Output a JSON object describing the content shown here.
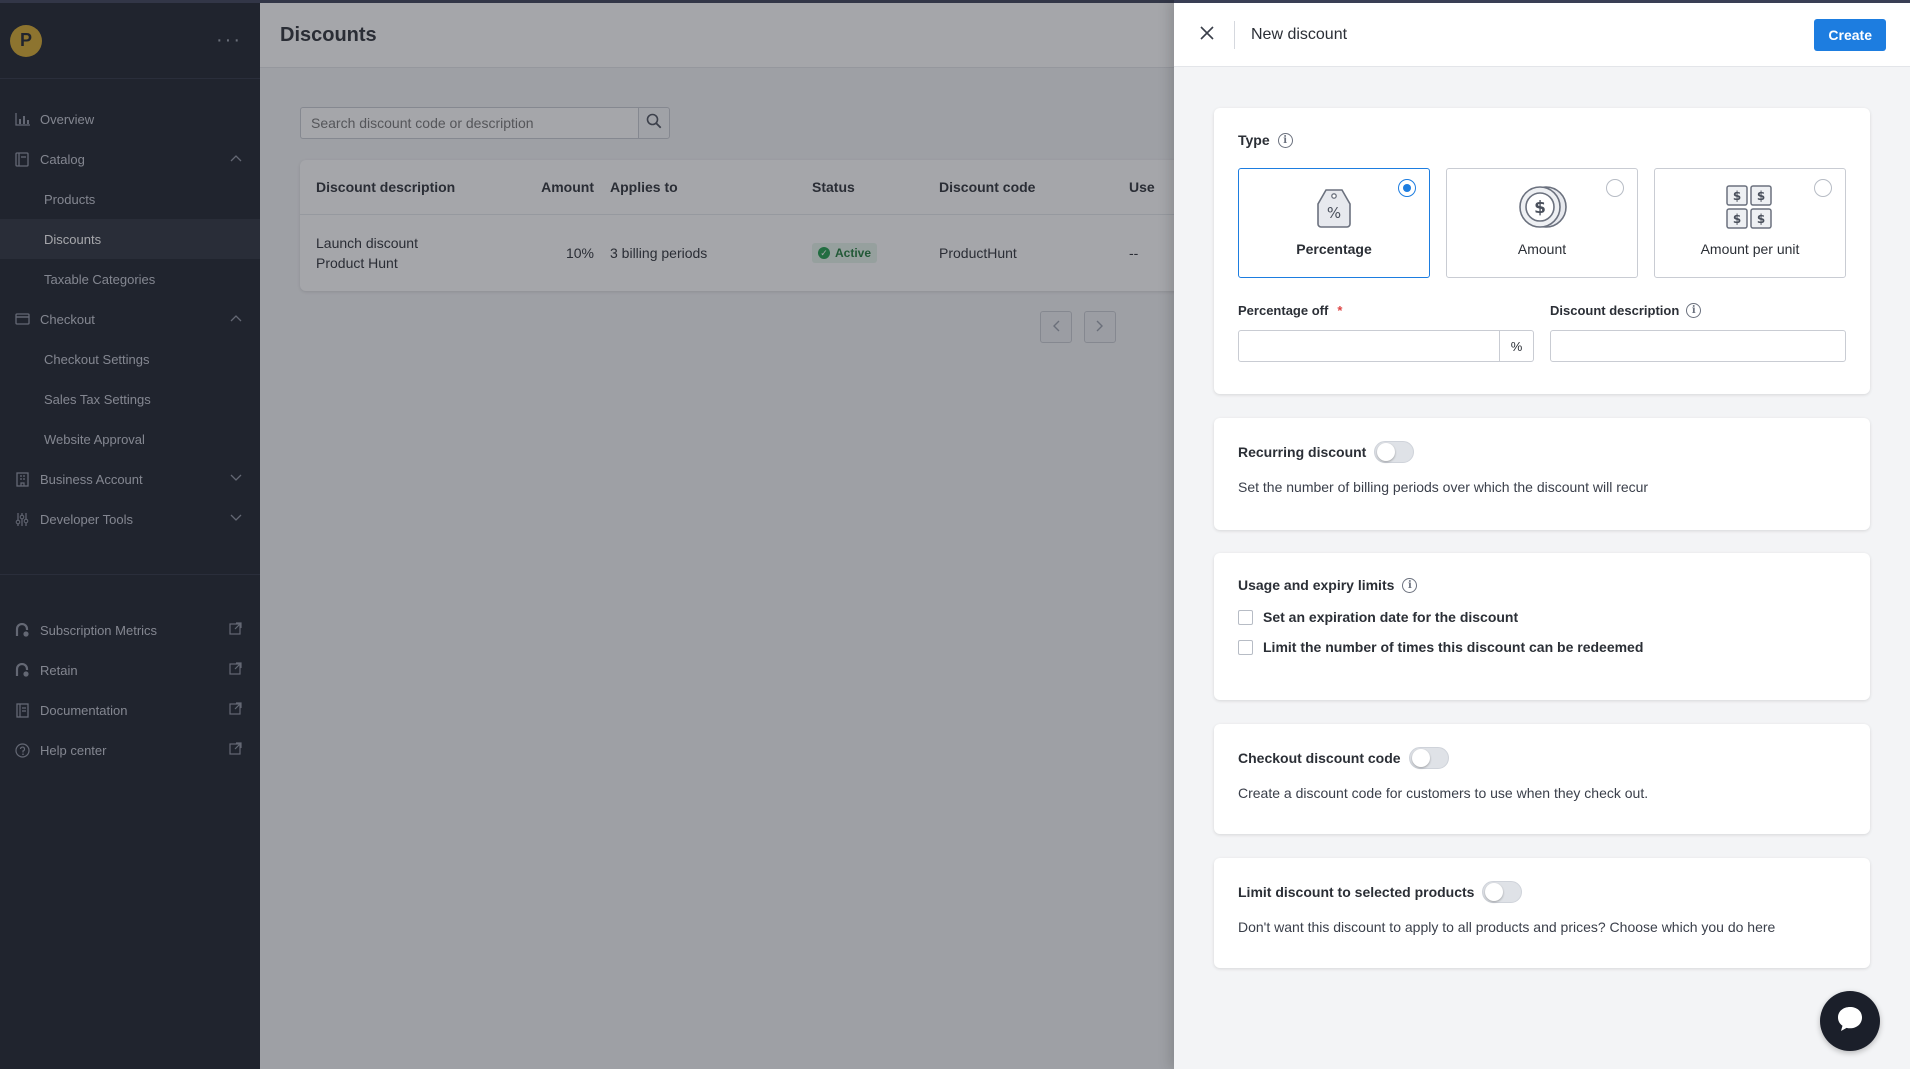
{
  "sidebar": {
    "logo_letter": "P",
    "menu_dots": "···",
    "items": [
      {
        "label": "Overview",
        "icon": "bar-chart-icon"
      },
      {
        "label": "Catalog",
        "icon": "catalog-icon"
      },
      {
        "label": "Products"
      },
      {
        "label": "Discounts"
      },
      {
        "label": "Taxable Categories"
      },
      {
        "label": "Checkout",
        "icon": "card-icon"
      },
      {
        "label": "Checkout Settings"
      },
      {
        "label": "Sales Tax Settings"
      },
      {
        "label": "Website Approval"
      },
      {
        "label": "Business Account",
        "icon": "building-icon"
      },
      {
        "label": "Developer Tools",
        "icon": "sliders-icon"
      }
    ],
    "external": [
      {
        "label": "Subscription Metrics"
      },
      {
        "label": "Retain"
      },
      {
        "label": "Documentation"
      },
      {
        "label": "Help center"
      }
    ]
  },
  "main": {
    "title": "Discounts",
    "search_placeholder": "Search discount code or description",
    "table": {
      "headers": [
        "Discount description",
        "Amount",
        "Applies to",
        "Status",
        "Discount code",
        "Use"
      ],
      "rows": [
        {
          "description_line1": "Launch discount",
          "description_line2": "Product Hunt",
          "amount": "10%",
          "applies_to": "3 billing periods",
          "status": "Active",
          "code": "ProductHunt",
          "uses": "--"
        }
      ]
    }
  },
  "drawer": {
    "title": "New discount",
    "create_label": "Create",
    "type_section": {
      "title": "Type",
      "options": [
        {
          "label": "Percentage",
          "selected": true
        },
        {
          "label": "Amount",
          "selected": false
        },
        {
          "label": "Amount per unit",
          "selected": false
        }
      ]
    },
    "percentage_off_label": "Percentage off",
    "percentage_suffix": "%",
    "description_label": "Discount description",
    "recurring": {
      "title": "Recurring discount",
      "description": "Set the number of billing periods over which the discount will recur"
    },
    "usage": {
      "title": "Usage and expiry limits",
      "checkbox1": "Set an expiration date for the discount",
      "checkbox2": "Limit the number of times this discount can be redeemed"
    },
    "checkout_code": {
      "title": "Checkout discount code",
      "description": "Create a discount code for customers to use when they check out."
    },
    "limit_products": {
      "title": "Limit discount to selected products",
      "description": "Don't want this discount to apply to all products and prices? Choose which you do here"
    }
  },
  "colors": {
    "accent": "#1d7de0",
    "sidebar_bg": "#1b1f2a",
    "logo": "#d6a92b",
    "status_active": "#1e9e4a"
  }
}
